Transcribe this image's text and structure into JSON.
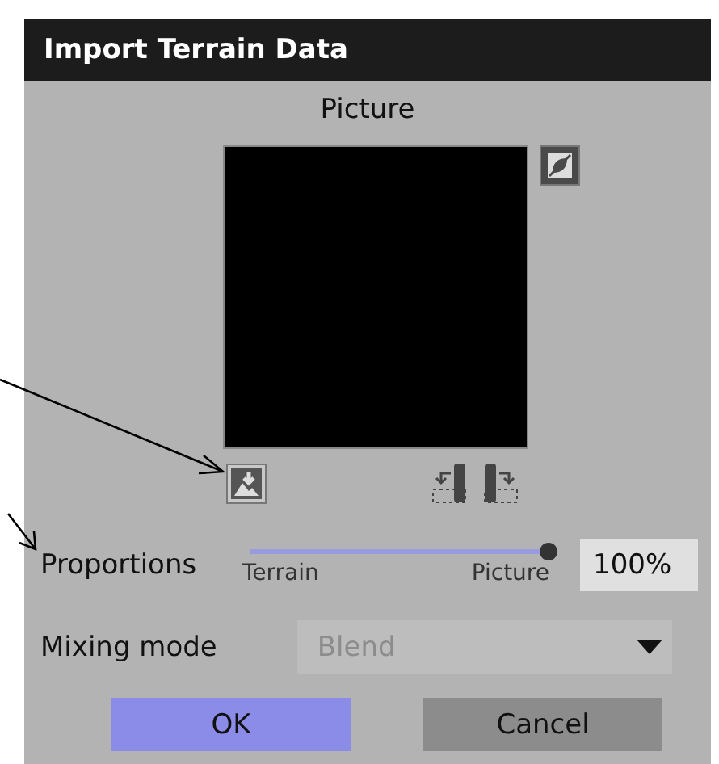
{
  "window": {
    "title": "Import Terrain Data"
  },
  "picture": {
    "label": "Picture"
  },
  "proportions": {
    "label": "Proportions",
    "level": 1,
    "min_label": "Terrain",
    "max_label": "Picture",
    "value": "100%"
  },
  "mixing_mode": {
    "label": "Mixing mode",
    "value": "Blend",
    "disabled": true
  },
  "buttons": [
    {
      "label": "OK",
      "kind": "primary"
    },
    {
      "label": "Cancel",
      "kind": "secondary"
    }
  ]
}
